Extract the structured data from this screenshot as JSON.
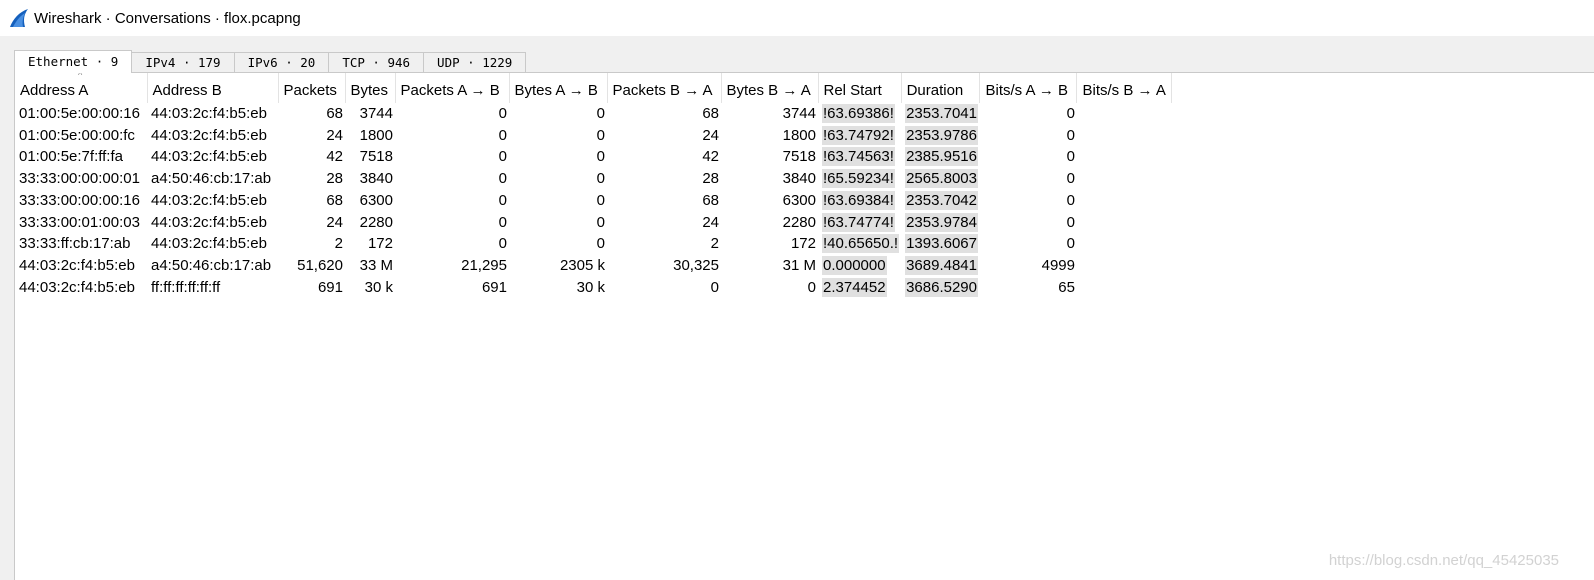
{
  "window": {
    "title": "Wireshark · Conversations · flox.pcapng",
    "icon": "wireshark-fin-icon",
    "accent": "#1560bd"
  },
  "tabs": [
    {
      "label": "Ethernet · 9",
      "active": true
    },
    {
      "label": "IPv4 · 179",
      "active": false
    },
    {
      "label": "IPv6 · 20",
      "active": false
    },
    {
      "label": "TCP · 946",
      "active": false
    },
    {
      "label": "UDP · 1229",
      "active": false
    }
  ],
  "table": {
    "columns": [
      "Address A",
      "Address B",
      "Packets",
      "Bytes",
      "Packets A → B",
      "Bytes A → B",
      "Packets B → A",
      "Bytes B → A",
      "Rel Start",
      "Duration",
      "Bits/s A → B",
      "Bits/s B → A"
    ],
    "sort_indicator": "^",
    "rows": [
      [
        "01:00:5e:00:00:16",
        "44:03:2c:f4:b5:eb",
        "68",
        "3744",
        "0",
        "0",
        "68",
        "3744",
        "!63.69386!",
        "2353.7041",
        "0",
        ""
      ],
      [
        "01:00:5e:00:00:fc",
        "44:03:2c:f4:b5:eb",
        "24",
        "1800",
        "0",
        "0",
        "24",
        "1800",
        "!63.74792!",
        "2353.9786",
        "0",
        ""
      ],
      [
        "01:00:5e:7f:ff:fa",
        "44:03:2c:f4:b5:eb",
        "42",
        "7518",
        "0",
        "0",
        "42",
        "7518",
        "!63.74563!",
        "2385.9516",
        "0",
        ""
      ],
      [
        "33:33:00:00:00:01",
        "a4:50:46:cb:17:ab",
        "28",
        "3840",
        "0",
        "0",
        "28",
        "3840",
        "!65.59234!",
        "2565.8003",
        "0",
        ""
      ],
      [
        "33:33:00:00:00:16",
        "44:03:2c:f4:b5:eb",
        "68",
        "6300",
        "0",
        "0",
        "68",
        "6300",
        "!63.69384!",
        "2353.7042",
        "0",
        ""
      ],
      [
        "33:33:00:01:00:03",
        "44:03:2c:f4:b5:eb",
        "24",
        "2280",
        "0",
        "0",
        "24",
        "2280",
        "!63.74774!",
        "2353.9784",
        "0",
        ""
      ],
      [
        "33:33:ff:cb:17:ab",
        "44:03:2c:f4:b5:eb",
        "2",
        "172",
        "0",
        "0",
        "2",
        "172",
        "!40.65650.!",
        "1393.6067",
        "0",
        ""
      ],
      [
        "44:03:2c:f4:b5:eb",
        "a4:50:46:cb:17:ab",
        "51,620",
        "33 M",
        "21,295",
        "2305 k",
        "30,325",
        "31 M",
        "0.000000",
        "3689.4841",
        "4999",
        ""
      ],
      [
        "44:03:2c:f4:b5:eb",
        "ff:ff:ff:ff:ff:ff",
        "691",
        "30 k",
        "691",
        "30 k",
        "0",
        "0",
        "2.374452",
        "3686.5290",
        "65",
        ""
      ]
    ]
  },
  "watermark": "https://blog.csdn.net/qq_45425035"
}
